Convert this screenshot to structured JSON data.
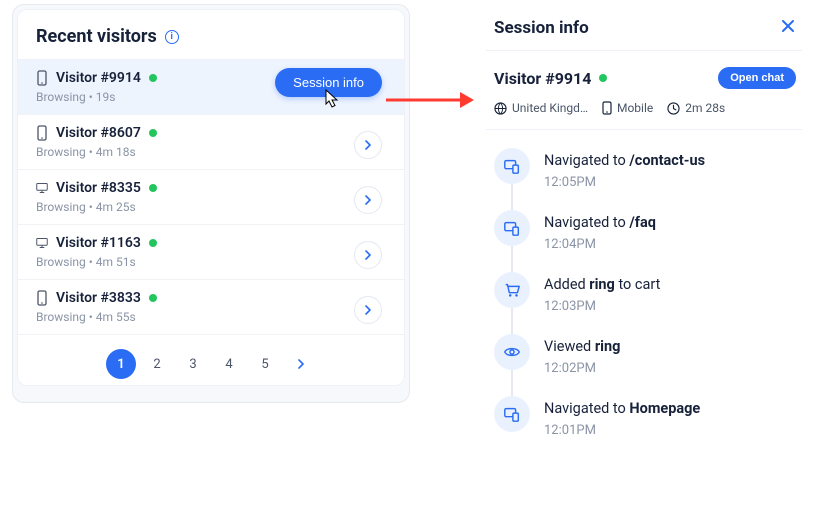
{
  "left": {
    "title": "Recent visitors",
    "session_info_label": "Session info",
    "visitors": [
      {
        "name": "Visitor #9914",
        "device": "mobile",
        "online": true,
        "status": "Browsing • 19s",
        "selected": true
      },
      {
        "name": "Visitor #8607",
        "device": "mobile",
        "online": true,
        "status": "Browsing • 4m 18s"
      },
      {
        "name": "Visitor #8335",
        "device": "desktop",
        "online": true,
        "status": "Browsing • 4m 25s"
      },
      {
        "name": "Visitor #1163",
        "device": "desktop",
        "online": true,
        "status": "Browsing • 4m 51s"
      },
      {
        "name": "Visitor #3833",
        "device": "mobile",
        "online": true,
        "status": "Browsing • 4m 55s"
      }
    ],
    "pages": [
      "1",
      "2",
      "3",
      "4",
      "5"
    ],
    "active_page": "1"
  },
  "right": {
    "title": "Session info",
    "visitor_name": "Visitor #9914",
    "open_chat_label": "Open chat",
    "meta": {
      "location": "United Kingd…",
      "device": "Mobile",
      "duration": "2m 28s"
    },
    "events": [
      {
        "icon": "nav",
        "prefix": "Navigated to ",
        "bold": "/contact-us",
        "suffix": "",
        "time": "12:05PM"
      },
      {
        "icon": "nav",
        "prefix": "Navigated to ",
        "bold": "/faq",
        "suffix": "",
        "time": "12:04PM"
      },
      {
        "icon": "cart",
        "prefix": "Added ",
        "bold": "ring",
        "suffix": " to cart",
        "time": "12:03PM"
      },
      {
        "icon": "eye",
        "prefix": "Viewed ",
        "bold": "ring",
        "suffix": "",
        "time": "12:02PM"
      },
      {
        "icon": "nav",
        "prefix": "Navigated to ",
        "bold": "Homepage",
        "suffix": "",
        "time": "12:01PM"
      }
    ]
  }
}
